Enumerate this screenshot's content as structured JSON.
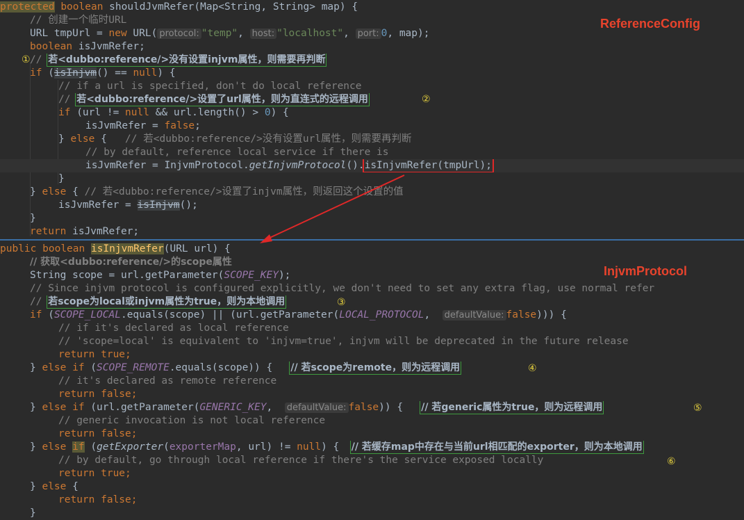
{
  "labels": {
    "reference_config": "ReferenceConfig",
    "injvm_protocol": "InjvmProtocol"
  },
  "markers": [
    "①",
    "②",
    "③",
    "④",
    "⑤",
    "⑥"
  ],
  "code": {
    "l1_kw": "protected",
    "l1_type": "boolean",
    "l1_rest": " shouldJvmRefer(Map<String, String> map) {",
    "l2": "// 创建一个临时URL",
    "l3_a": "URL tmpUrl = ",
    "l3_new": "new",
    "l3_b": " URL(",
    "l3_h1": "protocol:",
    "l3_s1": "\"temp\"",
    "l3_c1": ", ",
    "l3_h2": "host:",
    "l3_s2": "\"localhost\"",
    "l3_c2": ", ",
    "l3_h3": "port:",
    "l3_n": "0",
    "l3_end": ", map);",
    "l4_kw": "boolean",
    "l4_rest": " isJvmRefer;",
    "l5_cm": "// ",
    "l5_zh": "若<dubbo:reference/>没有设置injvm属性，则需要再判断",
    "l6_kw": "if",
    "l6_a": " (",
    "l6_m": "isInjvm",
    "l6_b": "() == ",
    "l6_null": "null",
    "l6_c": ") {",
    "l7": "// if a url is specified, don't do local reference",
    "l8_cm": "// ",
    "l8_zh": "若<dubbo:reference/>设置了url属性，则为直连式的远程调用",
    "l9_kw": "if",
    "l9_a": " (url != ",
    "l9_null": "null",
    "l9_b": " && url.length() > ",
    "l9_n": "0",
    "l9_c": ") {",
    "l10_a": "isJvmRefer = ",
    "l10_f": "false",
    "l10_b": ";",
    "l11_a": "} ",
    "l11_kw": "else",
    "l11_b": " {   ",
    "l11_cm": "// 若<dubbo:reference/>没有设置url属性，则需要再判断",
    "l12": "// by default, reference local service if there is",
    "l13_a": "isJvmRefer = InjvmProtocol.",
    "l13_m": "getInjvmProtocol",
    "l13_b": "().",
    "l13_box": "isInjvmRefer(tmpUrl);",
    "l14": "}",
    "l15_a": "} ",
    "l15_kw": "else",
    "l15_b": " { ",
    "l15_cm": "// 若<dubbo:reference/>设置了injvm属性，则返回这个设置的值",
    "l16_a": "isJvmRefer = ",
    "l16_m": "isInjvm",
    "l16_b": "();",
    "l17": "}",
    "l18_kw": "return",
    "l18_rest": " isJvmRefer;",
    "m1_kw": "public",
    "m1_type": "boolean",
    "m1_name": "isInjvmRefer",
    "m1_rest": "(URL url) {",
    "m2": "// 获取<dubbo:reference/>的scope属性",
    "m3_a": "String scope = url.getParameter(",
    "m3_f": "SCOPE_KEY",
    "m3_b": ");",
    "m4": "// Since injvm protocol is configured explicitly, we don't need to set any extra flag, use normal refer",
    "m5_cm": "// ",
    "m5_zh": "若scope为local或injvm属性为true，则为本地调用",
    "m6_kw": "if",
    "m6_a": " (",
    "m6_f": "SCOPE_LOCAL",
    "m6_b": ".equals(scope) || (url.getParameter(",
    "m6_f2": "LOCAL_PROTOCOL",
    "m6_c": ",  ",
    "m6_h": "defaultValue:",
    "m6_false": "false",
    "m6_d": "))) {",
    "m7": "// if it's declared as local reference",
    "m8": "// 'scope=local' is equivalent to 'injvm=true', injvm will be deprecated in the future release",
    "m9_kw": "return",
    "m9_v": " true",
    "m9_e": ";",
    "m10_a": "} ",
    "m10_kw": "else if",
    "m10_b": " (",
    "m10_f": "SCOPE_REMOTE",
    "m10_c": ".equals(scope)) {  ",
    "m10_cm": "// 若scope为remote，则为远程调用",
    "m11": "// it's declared as remote reference",
    "m12_kw": "return",
    "m12_v": " false",
    "m12_e": ";",
    "m13_a": "} ",
    "m13_kw": "else if",
    "m13_b": " (url.getParameter(",
    "m13_f": "GENERIC_KEY",
    "m13_c": ",  ",
    "m13_h": "defaultValue:",
    "m13_false": "false",
    "m13_d": ")) {  ",
    "m13_cm": "// 若generic属性为true，则为远程调用",
    "m14": "// generic invocation is not local reference",
    "m15_kw": "return",
    "m15_v": " false",
    "m15_e": ";",
    "m16_a": "} ",
    "m16_kw1": "else",
    "m16_kw2": "if",
    "m16_b": " (",
    "m16_m": "getExporter",
    "m16_c": "(",
    "m16_f": "exporterMap",
    "m16_d": ", url) != ",
    "m16_null": "null",
    "m16_e": ") {  ",
    "m16_cm": "// 若缓存map中存在与当前url相匹配的exporter，则为本地调用",
    "m17": "// by default, go through local reference if there's the service exposed locally",
    "m18_kw": "return",
    "m18_v": " true",
    "m18_e": ";",
    "m19_a": "} ",
    "m19_kw": "else",
    "m19_b": " {",
    "m20_kw": "return",
    "m20_v": " false",
    "m20_e": ";",
    "m21": "}"
  }
}
